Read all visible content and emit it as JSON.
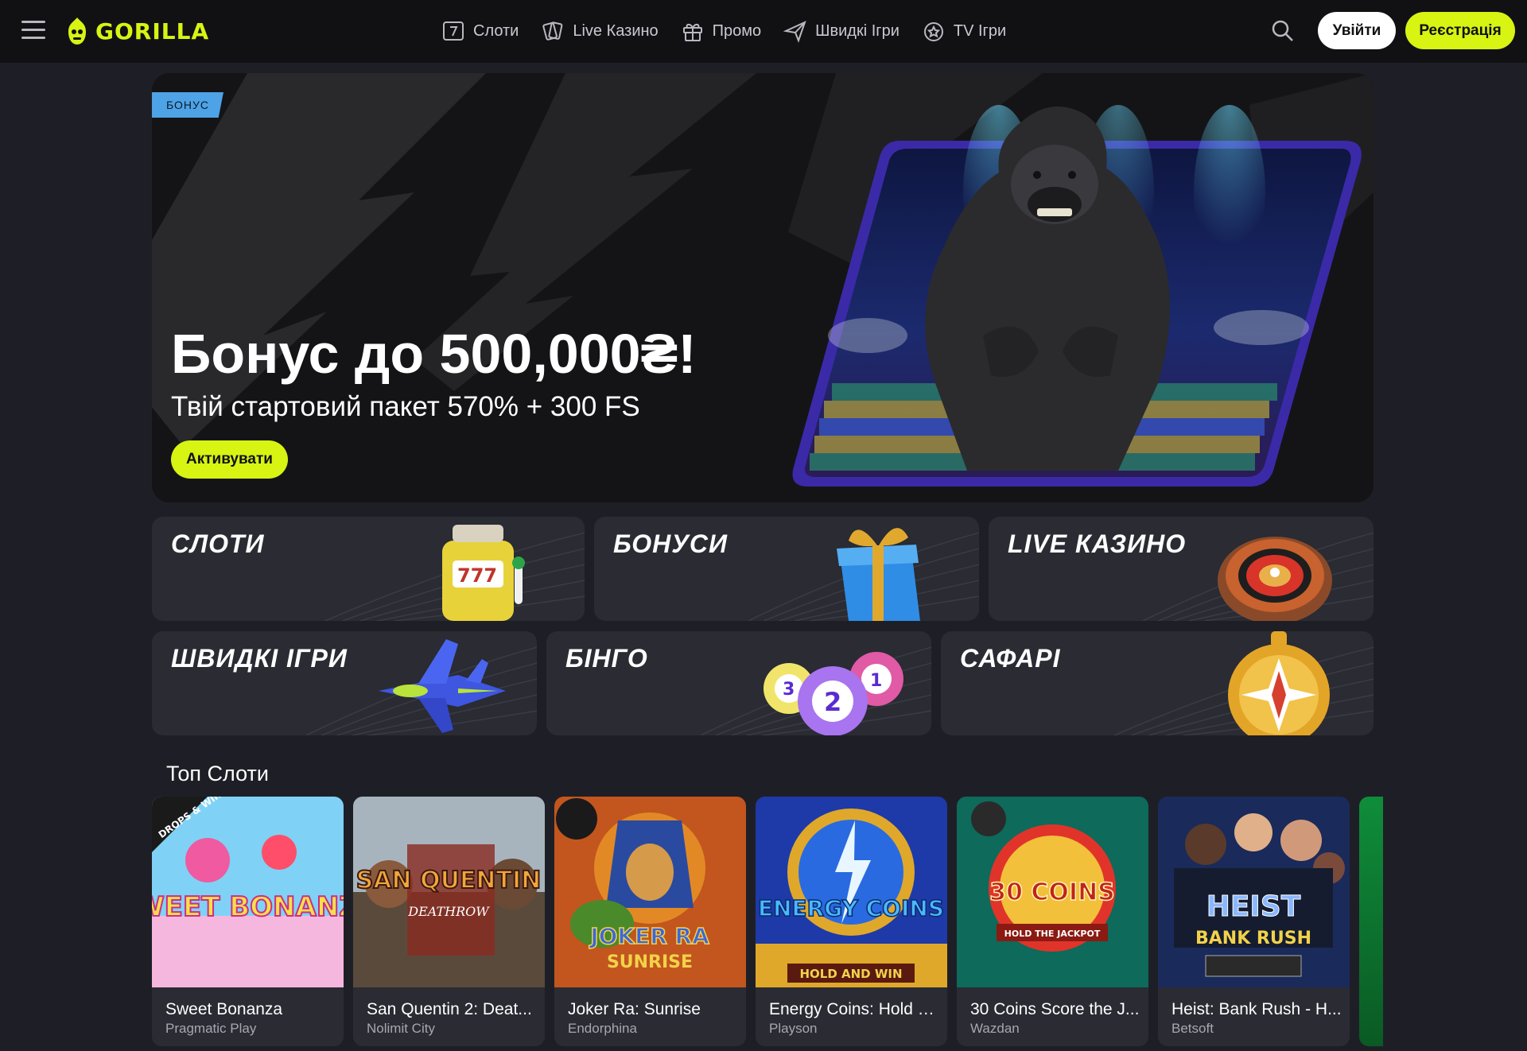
{
  "header": {
    "brand": "GORILLA",
    "nav": [
      {
        "label": "Слоти",
        "icon": "slot-seven-icon"
      },
      {
        "label": "Live Казино",
        "icon": "cards-icon"
      },
      {
        "label": "Промо",
        "icon": "gift-icon"
      },
      {
        "label": "Швидкі Ігри",
        "icon": "plane-icon"
      },
      {
        "label": "TV Ігри",
        "icon": "tv-star-icon"
      }
    ],
    "login": "Увійти",
    "register": "Реєстрація",
    "accent": "#d7f413"
  },
  "hero": {
    "badge": "БОНУС",
    "title": "Бонус до 500,000₴!",
    "subtitle": "Твій стартовий пакет 570% + 300 FS",
    "cta": "Активувати"
  },
  "categories": [
    {
      "label": "СЛОТИ"
    },
    {
      "label": "БОНУСИ"
    },
    {
      "label": "LIVE КАЗИНО"
    },
    {
      "label": "ШВИДКІ ІГРИ"
    },
    {
      "label": "БІНГО"
    },
    {
      "label": "САФАРІ"
    }
  ],
  "top_slots": {
    "title": "Топ Слоти",
    "games": [
      {
        "name": "Sweet Bonanza",
        "provider": "Pragmatic Play",
        "art_text": "SWEET BONANZA",
        "badge": "DROPS & WINS"
      },
      {
        "name": "San Quentin 2: Deat...",
        "provider": "Nolimit City",
        "art_text": "SAN QUENTIN",
        "art_sub": "DEATHROW"
      },
      {
        "name": "Joker Ra: Sunrise",
        "provider": "Endorphina",
        "art_text": "JOKER RA",
        "art_sub": "SUNRISE"
      },
      {
        "name": "Energy Coins: Hold a...",
        "provider": "Playson",
        "art_text": "ENERGY COINS",
        "art_sub": "HOLD AND WIN"
      },
      {
        "name": "30 Coins Score the J...",
        "provider": "Wazdan",
        "art_text": "30 COINS",
        "art_sub": "HOLD THE JACKPOT"
      },
      {
        "name": "Heist: Bank Rush - H...",
        "provider": "Betsoft",
        "art_text": "HEIST",
        "art_sub": "BANK RUSH"
      }
    ]
  }
}
